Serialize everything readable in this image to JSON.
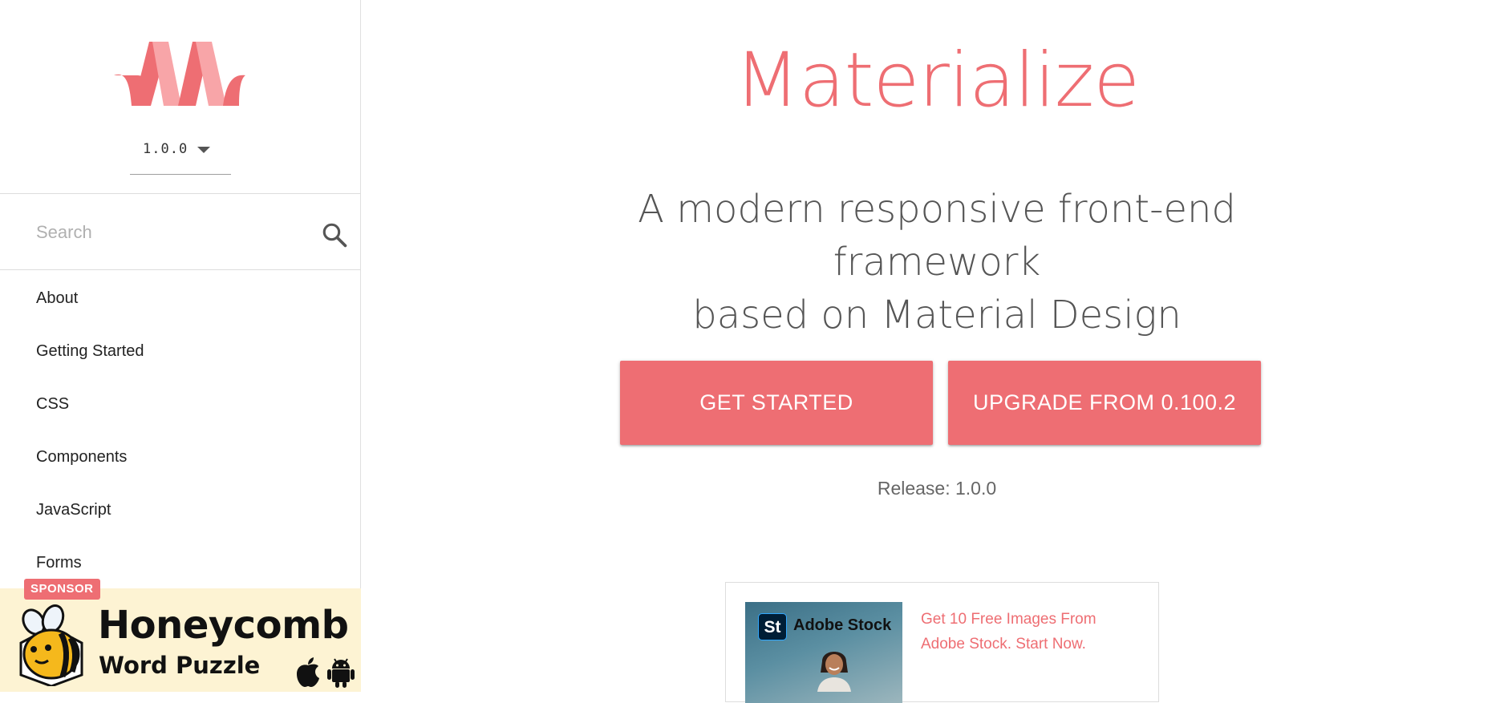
{
  "brand": {
    "accent_color": "#ee6e73"
  },
  "sidebar": {
    "logo_icon": "materialize-logo",
    "version": {
      "selected": "1.0.0"
    },
    "search": {
      "placeholder": "Search",
      "value": ""
    },
    "nav_items": [
      {
        "label": "About"
      },
      {
        "label": "Getting Started"
      },
      {
        "label": "CSS"
      },
      {
        "label": "Components"
      },
      {
        "label": "JavaScript"
      },
      {
        "label": "Forms"
      }
    ],
    "sponsor": {
      "badge": "SPONSOR",
      "title": "Honeycomb",
      "subtitle": "Word Puzzle",
      "icons": [
        "bee-icon",
        "apple-icon",
        "android-icon"
      ]
    }
  },
  "main": {
    "title": "Materialize",
    "tagline_line1": "A modern responsive front-end framework",
    "tagline_line2": "based on Material Design",
    "buttons": {
      "get_started": "GET STARTED",
      "upgrade": "UPGRADE FROM 0.100.2"
    },
    "release": "Release: 1.0.0",
    "ad": {
      "image_badge": "St",
      "image_brand": "Adobe Stock",
      "text": "Get 10 Free Images From Adobe Stock. Start Now."
    }
  }
}
